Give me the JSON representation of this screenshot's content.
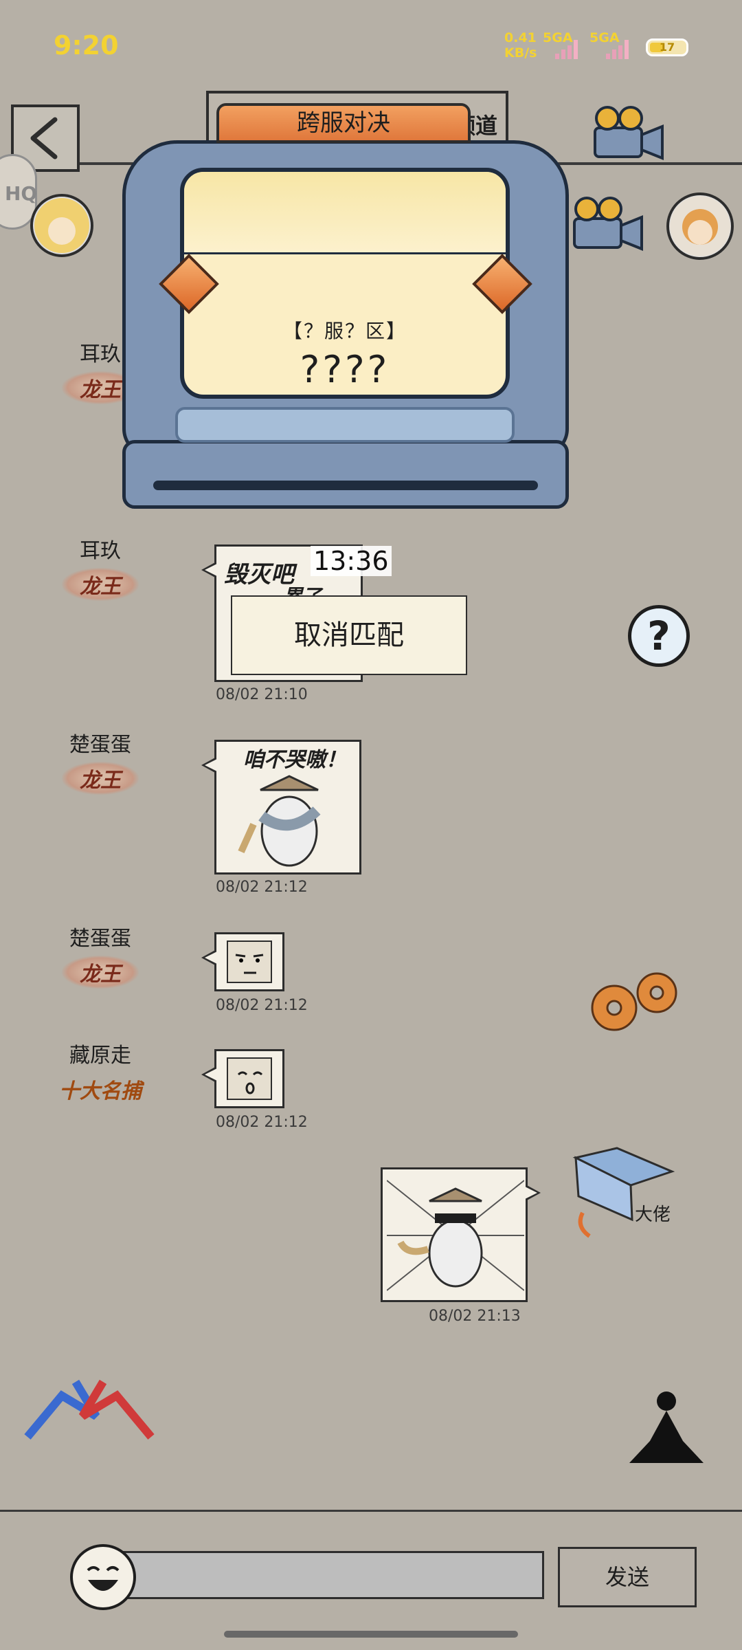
{
  "status": {
    "time": "9:20",
    "net_speed": "0.41",
    "net_unit": "KB/s",
    "sim1": "5GA",
    "sim2": "5GA",
    "battery": "17"
  },
  "header": {
    "tab_suffix": "频道",
    "hq_label": "HQ"
  },
  "modal": {
    "title": "跨服对决",
    "server_label": "【？服？区】",
    "server_name": "????",
    "timer": "13:36",
    "cancel_label": "取消匹配"
  },
  "messages": [
    {
      "sender": "耳玖",
      "title": "龙王",
      "timestamp": ""
    },
    {
      "sender": "耳玖",
      "title": "龙王",
      "text": "毁灭吧",
      "text2": "累了",
      "timestamp": "08/02 21:10"
    },
    {
      "sender": "楚蛋蛋",
      "title": "龙王",
      "text": "咱不哭嗷！",
      "timestamp": "08/02 21:12"
    },
    {
      "sender": "楚蛋蛋",
      "title": "龙王",
      "timestamp": "08/02 21:12"
    },
    {
      "sender": "藏原走",
      "title": "十大名捕",
      "timestamp": "08/02 21:12"
    },
    {
      "sender": "",
      "title": "",
      "timestamp": "08/02 21:13"
    }
  ],
  "side": {
    "book_label": "大佬"
  },
  "input": {
    "placeholder": "",
    "send_label": "发送"
  },
  "colors": {
    "status_yellow": "#f3d232",
    "modal_blue": "#7f95b4",
    "modal_orange": "#e0783c",
    "background": "#b6b0a6"
  }
}
